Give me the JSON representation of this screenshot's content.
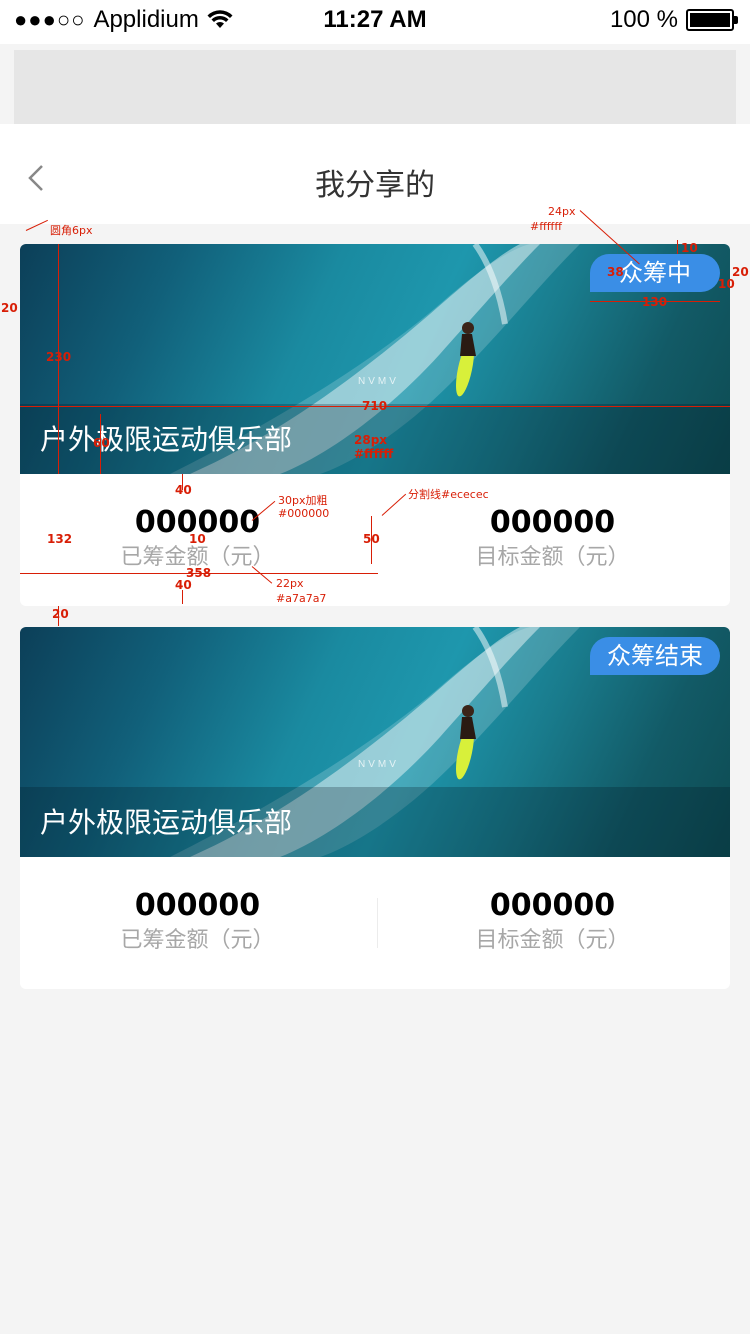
{
  "status_bar": {
    "signal": "●●●○○",
    "carrier": "Applidium",
    "time": "11:27 AM",
    "battery_text": "100 %"
  },
  "nav": {
    "title": "我分享的",
    "back_icon": "chevron-left-icon"
  },
  "cards": [
    {
      "badge": "众筹中",
      "club_name": "户外极限运动俱乐部",
      "logo_text": "NVMV",
      "raised_value": "000000",
      "raised_label": "已筹金额（元）",
      "target_value": "000000",
      "target_label": "目标金额（元）"
    },
    {
      "badge": "众筹结束",
      "club_name": "户外极限运动俱乐部",
      "logo_text": "NVMV",
      "raised_value": "000000",
      "raised_label": "已筹金额（元）",
      "target_value": "000000",
      "target_label": "目标金额（元）"
    }
  ],
  "annotations": {
    "corner_radius": "圆角6px",
    "badge_font": "24px",
    "badge_color": "#ffffff",
    "badge_top_gap": "10",
    "badge_right_gap": "20",
    "badge_right_gap_b": "10",
    "badge_height": "38",
    "badge_width": "130",
    "left_margin": "20",
    "banner_height": "230",
    "banner_width": "710",
    "title_font": "28px",
    "title_color": "#ffffff",
    "title_offset": "60",
    "num_font": "30px加粗",
    "num_color": "#000000",
    "divider_note": "分割线#ececec",
    "gap_top": "40",
    "stats_height": "132",
    "gap_mid": "10",
    "divider_height": "50",
    "half_width": "358",
    "gap_bottom": "40",
    "label_font": "22px",
    "label_color": "#a7a7a7",
    "card_gap": "20"
  },
  "colors": {
    "accent": "#3a8ee6",
    "annotation": "#d81e06"
  }
}
